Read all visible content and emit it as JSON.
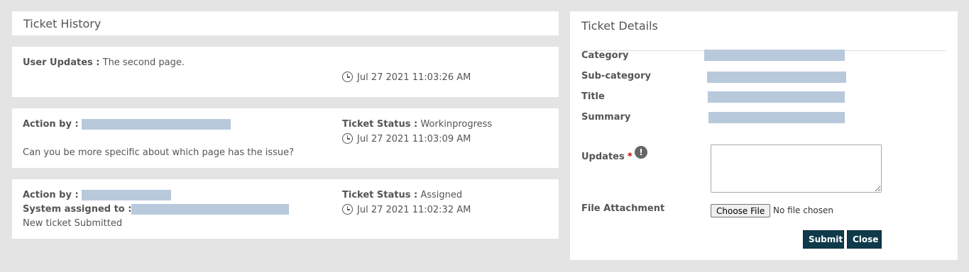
{
  "history": {
    "title": "Ticket History",
    "entries": [
      {
        "label": "User Updates :",
        "text": "The second page.",
        "timestamp": "Jul 27 2021 11:03:26 AM"
      },
      {
        "action_label": "Action by :",
        "status_label": "Ticket Status :",
        "status_value": "Workinprogress",
        "timestamp": "Jul 27 2021 11:03:09 AM",
        "message": "Can you be more specific about which page has the issue?"
      },
      {
        "action_label": "Action by :",
        "assigned_label": "System assigned to :",
        "status_label": "Ticket Status :",
        "status_value": "Assigned",
        "timestamp": "Jul 27 2021 11:02:32 AM",
        "message": "New ticket Submitted"
      }
    ]
  },
  "details": {
    "title": "Ticket Details",
    "fields": {
      "category": "Category",
      "subcategory": "Sub-category",
      "title": "Title",
      "summary": "Summary"
    },
    "updates_label": "Updates",
    "required_mark": "*",
    "info_icon": "!",
    "file_label": "File Attachment",
    "choose_file": "Choose File",
    "no_file": "No file chosen",
    "submit": "Submit",
    "close": "Close"
  },
  "colors": {
    "page_bg": "#e4e4e4",
    "redaction": "#b8c9dc",
    "button_dark": "#0f3a4a"
  }
}
